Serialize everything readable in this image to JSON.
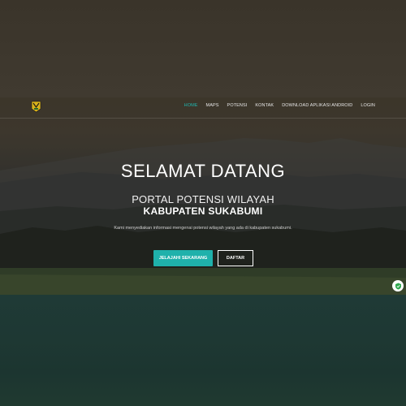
{
  "nav": {
    "items": [
      {
        "label": "HOME",
        "active": true
      },
      {
        "label": "MAPS",
        "active": false
      },
      {
        "label": "POTENSI",
        "active": false
      },
      {
        "label": "KONTAK",
        "active": false
      },
      {
        "label": "DOWNLOAD APLIKASI ANDROID",
        "active": false
      },
      {
        "label": "LOGIN",
        "active": false
      }
    ]
  },
  "hero": {
    "title": "SELAMAT DATANG",
    "subtitle": "PORTAL POTENSI WILAYAH",
    "subtitle_bold": "KABUPATEN SUKABUMI",
    "description": "Kami menyediakan informasi mengenai potensi wilayah yang ada di kabupaten sukabumi.",
    "primary_button": "JELAJAHI SEKARANG",
    "secondary_button": "DAFTAR"
  },
  "colors": {
    "accent": "#1fb1ab",
    "text": "#ffffff"
  },
  "icons": {
    "logo": "regency-emblem-icon",
    "widget": "shield-check-icon"
  }
}
